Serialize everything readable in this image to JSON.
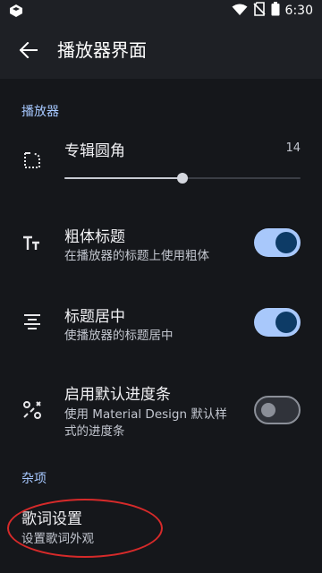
{
  "status_bar": {
    "time": "6:30"
  },
  "app_bar": {
    "title": "播放器界面"
  },
  "sections": {
    "player": "播放器",
    "misc": "杂项"
  },
  "album_corner": {
    "title": "专辑圆角",
    "value": "14",
    "slider_fraction": 0.5
  },
  "bold_title": {
    "title": "粗体标题",
    "subtitle": "在播放器的标题上使用粗体",
    "enabled": true
  },
  "center_title": {
    "title": "标题居中",
    "subtitle": "使播放器的标题居中",
    "enabled": true
  },
  "default_progress": {
    "title": "启用默认进度条",
    "subtitle_line1": "使用 Material Design 默认样",
    "subtitle_line2": "式的进度条",
    "enabled": false
  },
  "lyrics": {
    "title": "歌词设置",
    "subtitle": "设置歌词外观"
  },
  "colors": {
    "background": "#15171b",
    "app_bar": "#1e2025",
    "accent": "#a6c8ff",
    "switch_on_track": "#a8c8fb",
    "switch_on_knob": "#0d3b66",
    "annotation": "#d62a2a"
  }
}
